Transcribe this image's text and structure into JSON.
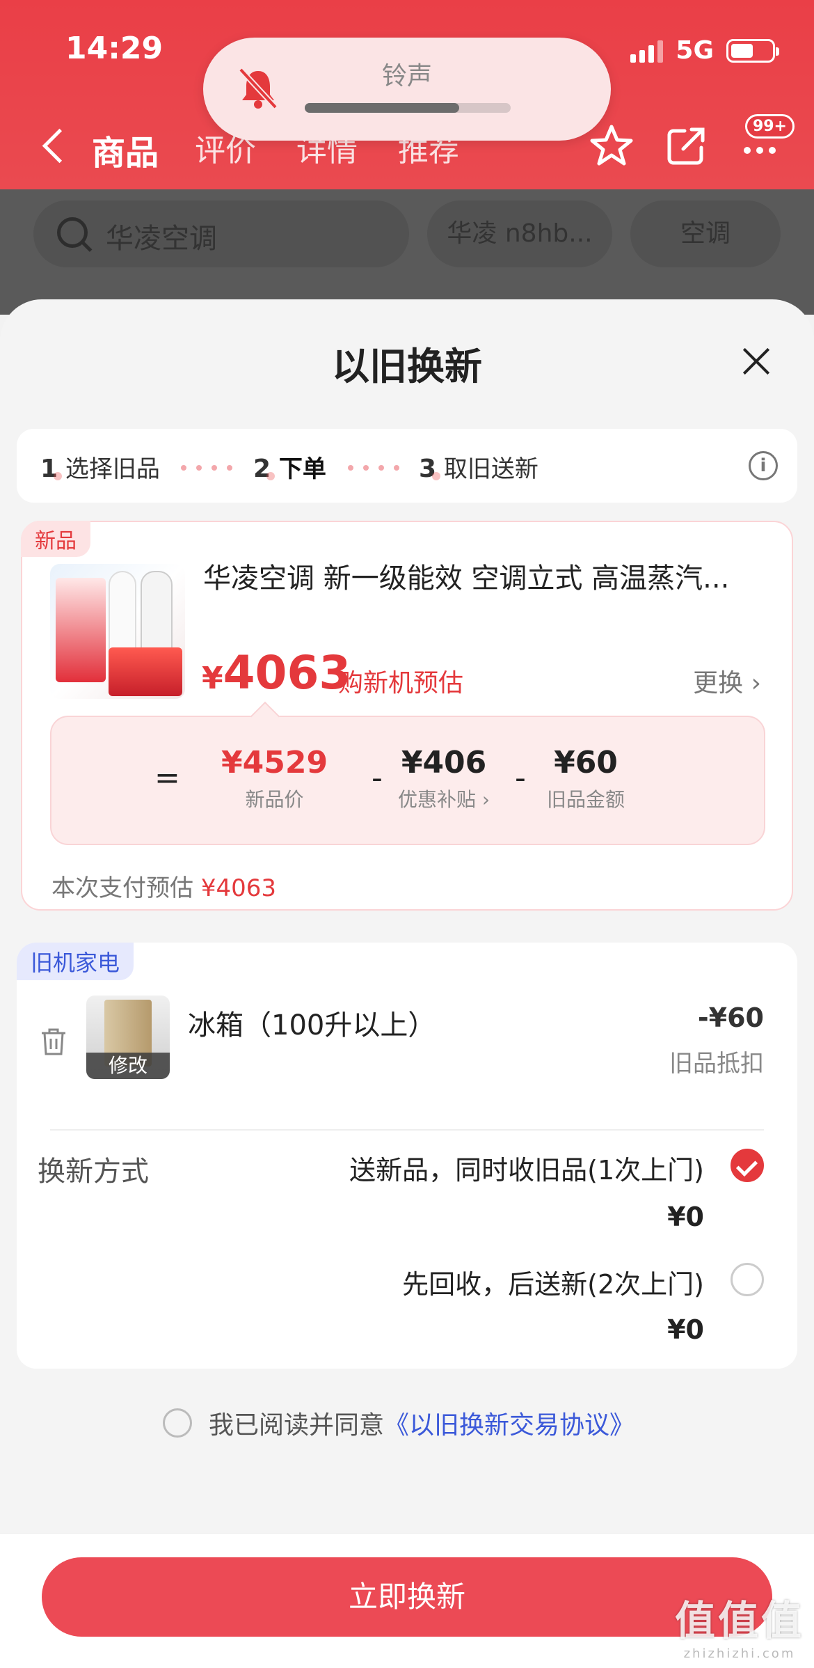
{
  "status_bar": {
    "time": "14:29",
    "network": "5G"
  },
  "ringer": {
    "label": "铃声",
    "level": 0.75
  },
  "nav": {
    "tabs": [
      "商品",
      "评价",
      "详情",
      "推荐"
    ],
    "badge": "99+"
  },
  "search": {
    "text": "华凌空调",
    "chips": [
      "华凌 n8hb...",
      "空调"
    ]
  },
  "sheet": {
    "title": "以旧换新",
    "steps": [
      {
        "num": "1",
        "label": "选择旧品"
      },
      {
        "num": "2",
        "label": "下单"
      },
      {
        "num": "3",
        "label": "取旧送新"
      }
    ]
  },
  "new_product": {
    "tag": "新品",
    "name": "华凌空调 新一级能效 空调立式 高温蒸汽...",
    "price_symbol": "¥",
    "price": "4063",
    "price_note": "购新机预估",
    "change_label": "更换",
    "breakdown": {
      "eq": "=",
      "minus": "-",
      "new_price": "¥4529",
      "new_price_label": "新品价",
      "subsidy": "¥406",
      "subsidy_label": "优惠补贴",
      "old_amount": "¥60",
      "old_amount_label": "旧品金额"
    },
    "pay_est_label": "本次支付预估",
    "pay_est_value": "¥4063"
  },
  "old_appliance": {
    "tag": "旧机家电",
    "name": "冰箱（100升以上）",
    "edit_label": "修改",
    "deduct": "-¥60",
    "deduct_label": "旧品抵扣",
    "method_label": "换新方式",
    "options": [
      {
        "text": "送新品，同时收旧品(1次上门)",
        "price": "¥0",
        "selected": true
      },
      {
        "text": "先回收，后送新(2次上门)",
        "price": "¥0",
        "selected": false
      }
    ]
  },
  "agreement": {
    "prefix": "我已阅读并同意",
    "link": "《以旧换新交易协议》"
  },
  "cta": {
    "label": "立即换新"
  },
  "watermark": {
    "main": "值值值",
    "sub": "zhizhizhi.com"
  },
  "colors": {
    "brand_red": "#e4393c",
    "header_red": "#ea3f47",
    "link_blue": "#3b59d9"
  }
}
